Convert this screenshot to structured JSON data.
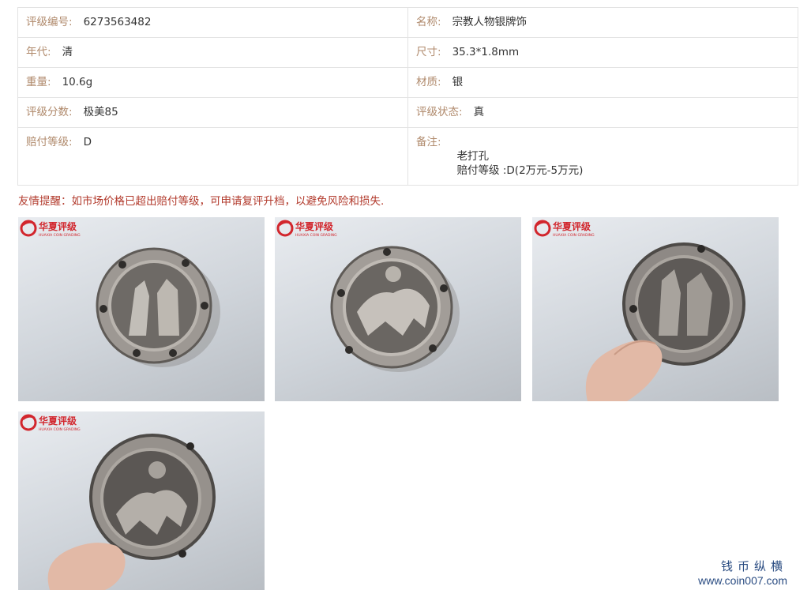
{
  "details": {
    "rows": [
      {
        "left_label": "评级编号:",
        "left_value": "6273563482",
        "right_label": "名称:",
        "right_value": "宗教人物银牌饰"
      },
      {
        "left_label": "年代:",
        "left_value": "清",
        "right_label": "尺寸:",
        "right_value": "35.3*1.8mm"
      },
      {
        "left_label": "重量:",
        "left_value": "10.6g",
        "right_label": "材质:",
        "right_value": "银"
      },
      {
        "left_label": "评级分数:",
        "left_value": "极美85",
        "right_label": "评级状态:",
        "right_value": "真"
      },
      {
        "left_label": "赔付等级:",
        "left_value": "D",
        "right_label": "备注:",
        "right_value": ""
      }
    ],
    "notes": [
      "老打孔",
      "赔付等级 :D(2万元-5万元)"
    ]
  },
  "reminder": "友情提醒：如市场价格已超出赔付等级，可申请复评升档，以避免风险和损失.",
  "watermark": {
    "brand": "华夏评级",
    "sub": "HUAXIA COIN GRADING",
    "color": "#d2262d"
  },
  "site": {
    "cn": "钱币纵横",
    "url": "www.coin007.com"
  },
  "photos": [
    {
      "subject": "silver-plaque-front"
    },
    {
      "subject": "silver-plaque-back"
    },
    {
      "subject": "silver-plaque-held-front"
    },
    {
      "subject": "silver-plaque-held-back"
    }
  ]
}
